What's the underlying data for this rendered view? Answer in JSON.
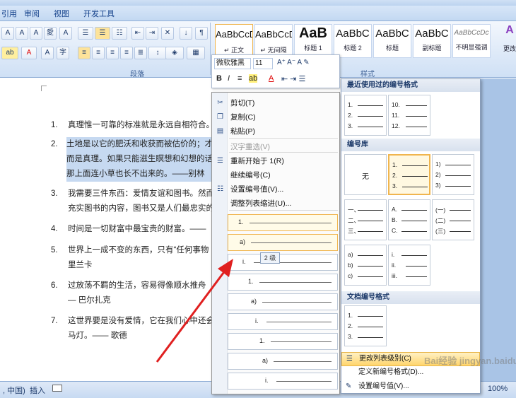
{
  "tabs": [
    "引用",
    "审阅",
    "视图",
    "开发工具"
  ],
  "ribbon": {
    "group_paragraph": "段落",
    "group_style": "样式",
    "styles": [
      {
        "preview": "AaBbCcD",
        "name": "↵ 正文"
      },
      {
        "preview": "AaBbCcD",
        "name": "↵ 无间隔"
      },
      {
        "preview": "AaB",
        "name": "标题 1"
      },
      {
        "preview": "AaBbC",
        "name": "标题 2"
      },
      {
        "preview": "AaBbC",
        "name": "标题"
      },
      {
        "preview": "AaBbC",
        "name": "副标题"
      },
      {
        "preview": "AaBbCcDc",
        "name": "不明显强调"
      }
    ],
    "change_style": "更改"
  },
  "document": {
    "items": [
      {
        "num": "1.",
        "lines": [
          "真理惟一可靠的标准就是永远自相符合。"
        ]
      },
      {
        "num": "2.",
        "lines": [
          "土地是以它的肥沃和收获而被估价的；才",
          "而是真理。如果只能滋生瞑想和幻想的话",
          "那上面连小草也长不出来的。——别林"
        ]
      },
      {
        "num": "3.",
        "lines": [
          "我需要三件东西：爱情友谊和图书。然而",
          "充实图书的内容，图书又是人们最忠实的"
        ]
      },
      {
        "num": "4.",
        "lines": [
          "时间是一切财富中最宝贵的财富。——"
        ]
      },
      {
        "num": "5.",
        "lines": [
          "世界上一成不变的东西，只有“任何事物",
          "里兰卡"
        ]
      },
      {
        "num": "6.",
        "lines": [
          "过放荡不羁的生活，容易得像顺水推舟",
          "— 巴尔扎克"
        ]
      },
      {
        "num": "7.",
        "lines": [
          "这世界要是没有爱情，它在我们心中还会",
          "马灯。—— 歌德"
        ]
      }
    ]
  },
  "mini_toolbar": {
    "font": "微软雅黑",
    "size": "11"
  },
  "context_menu": {
    "items": [
      {
        "label": "剪切(T)",
        "icon": "scissors-icon",
        "disabled": false
      },
      {
        "label": "复制(C)",
        "icon": "copy-icon",
        "disabled": false
      },
      {
        "label": "粘贴(P)",
        "icon": "paste-icon",
        "disabled": false
      },
      {
        "label": "汉字重选(V)",
        "icon": "",
        "disabled": true
      },
      {
        "label": "重新开始于 1(R)",
        "icon": "restart-list-icon",
        "disabled": false
      },
      {
        "label": "继续编号(C)",
        "icon": "",
        "disabled": false
      },
      {
        "label": "设置编号值(V)...",
        "icon": "numbering-value-icon",
        "disabled": false
      },
      {
        "label": "调整列表缩进(U)...",
        "icon": "",
        "disabled": false
      }
    ],
    "levels": [
      "1.",
      "a)",
      "i.",
      "1.",
      "a)",
      "i.",
      "1.",
      "a)",
      "i."
    ]
  },
  "tooltip": "2 级",
  "numbering_panel": {
    "recent_header": "最近使用过的编号格式",
    "recent": [
      [
        "1.",
        "2.",
        "3."
      ],
      [
        "10.",
        "11.",
        "12."
      ]
    ],
    "library_header": "编号库",
    "library_none": "无",
    "library": [
      [
        "1.",
        "2.",
        "3."
      ],
      [
        "1)",
        "2)",
        "3)"
      ],
      [
        "一、",
        "二、",
        "三、"
      ],
      [
        "A.",
        "B.",
        "C."
      ],
      [
        "(一)",
        "(二)",
        "(三)"
      ],
      [
        "a)",
        "b)",
        "c)"
      ],
      [
        "i.",
        "ii.",
        "iii."
      ]
    ],
    "doc_header": "文档编号格式",
    "doc": [
      [
        "1.",
        "2.",
        "3."
      ]
    ],
    "change_level": "更改列表级别(C)",
    "define_new": "定义新编号格式(D)...",
    "set_value": "设置编号值(V)..."
  },
  "status": {
    "lang": ", 中国)",
    "mode": "插入",
    "zoom": "100%"
  },
  "watermark": "Bai经验 jingyan.baidu.com"
}
